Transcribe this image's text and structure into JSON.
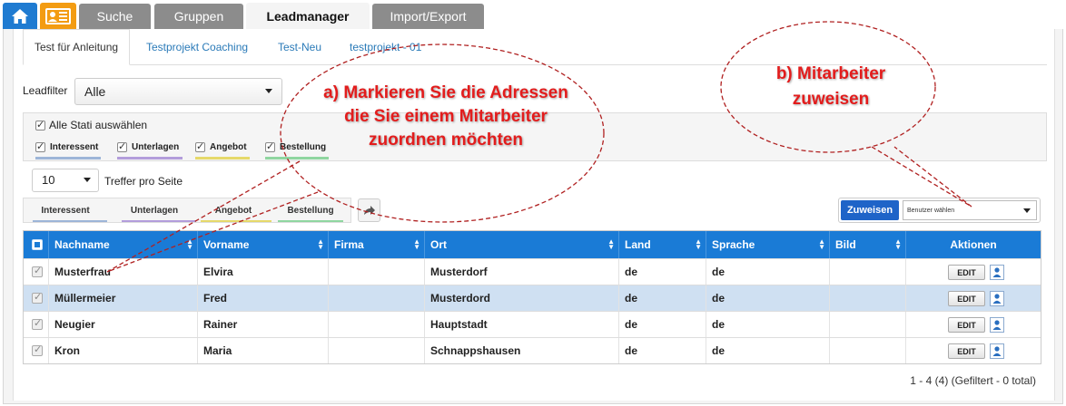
{
  "top_tabs": [
    {
      "label": "Suche"
    },
    {
      "label": "Gruppen"
    },
    {
      "label": "Leadmanager"
    },
    {
      "label": "Import/Export"
    }
  ],
  "sub_tabs": [
    {
      "label": "Test für Anleitung"
    },
    {
      "label": "Testprojekt Coaching"
    },
    {
      "label": "Test-Neu"
    },
    {
      "label": "testprojekt - 01"
    }
  ],
  "leadfilter": {
    "label": "Leadfilter",
    "value": "Alle"
  },
  "stati": {
    "select_all_label": "Alle Stati auswählen",
    "items": [
      {
        "label": "Interessent",
        "color": "#9db5d8"
      },
      {
        "label": "Unterlagen",
        "color": "#b39ddb"
      },
      {
        "label": "Angebot",
        "color": "#e6d96a"
      },
      {
        "label": "Bestellung",
        "color": "#8fd6a0"
      }
    ]
  },
  "per_page": {
    "value": "10",
    "label": "Treffer pro Seite"
  },
  "filter_buttons": [
    {
      "label": "Interessent",
      "color": "#9db5d8"
    },
    {
      "label": "Unterlagen",
      "color": "#b39ddb"
    },
    {
      "label": "Angebot",
      "color": "#e6d96a"
    },
    {
      "label": "Bestellung",
      "color": "#8fd6a0"
    }
  ],
  "assign": {
    "button_label": "Zuweisen",
    "select_value": "Benutzer wählen"
  },
  "table": {
    "columns": [
      "Nachname",
      "Vorname",
      "Firma",
      "Ort",
      "Land",
      "Sprache",
      "Bild",
      "Aktionen"
    ],
    "rows": [
      {
        "nachname": "Musterfrau",
        "vorname": "Elvira",
        "firma": "",
        "ort": "Musterdorf",
        "land": "de",
        "sprache": "de",
        "edit": "EDIT"
      },
      {
        "nachname": "Müllermeier",
        "vorname": "Fred",
        "firma": "",
        "ort": "Musterdord",
        "land": "de",
        "sprache": "de",
        "edit": "EDIT"
      },
      {
        "nachname": "Neugier",
        "vorname": "Rainer",
        "firma": "",
        "ort": "Hauptstadt",
        "land": "de",
        "sprache": "de",
        "edit": "EDIT"
      },
      {
        "nachname": "Kron",
        "vorname": "Maria",
        "firma": "",
        "ort": "Schnappshausen",
        "land": "de",
        "sprache": "de",
        "edit": "EDIT"
      }
    ]
  },
  "pagination_info": "1 - 4 (4) (Gefiltert - 0 total)",
  "annotations": {
    "a_text": "a) Markieren Sie die Adressen die Sie einem Mitarbeiter zuordnen möchten",
    "b_text": "b) Mitarbeiter zuweisen",
    "color": "#e31c1c"
  },
  "colors": {
    "accent": "#1a7bd6",
    "home": "#1f7bd1",
    "card": "#f39c12",
    "tab_inactive": "#8c8c8c"
  }
}
